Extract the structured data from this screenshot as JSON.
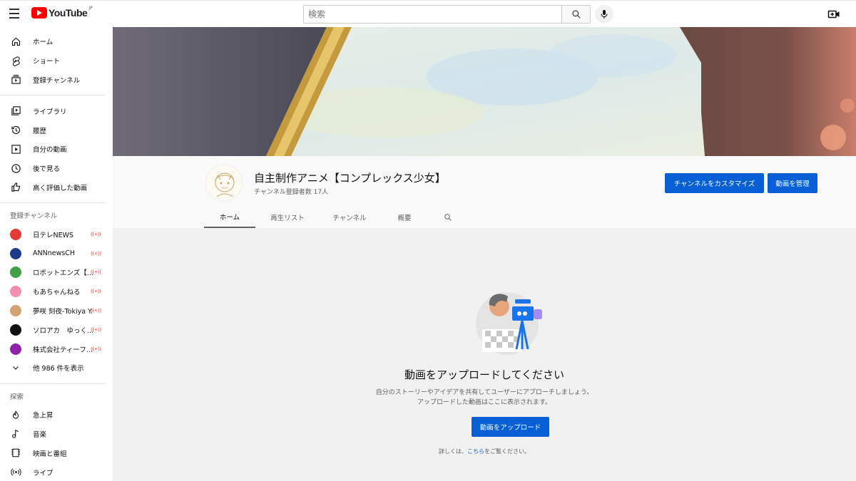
{
  "header": {
    "logo_text": "YouTube",
    "logo_region": "JP",
    "search_placeholder": "検索"
  },
  "sidebar": {
    "primary": [
      {
        "label": "ホーム",
        "icon": "home-icon"
      },
      {
        "label": "ショート",
        "icon": "shorts-icon"
      },
      {
        "label": "登録チャンネル",
        "icon": "subscriptions-icon"
      }
    ],
    "library": [
      {
        "label": "ライブラリ",
        "icon": "library-icon"
      },
      {
        "label": "履歴",
        "icon": "history-icon"
      },
      {
        "label": "自分の動画",
        "icon": "your-videos-icon"
      },
      {
        "label": "後で見る",
        "icon": "watch-later-icon"
      },
      {
        "label": "高く評価した動画",
        "icon": "liked-icon"
      }
    ],
    "subscriptions_heading": "登録チャンネル",
    "subscriptions": [
      {
        "label": "日テレNEWS",
        "color": "#e53935",
        "live": true
      },
      {
        "label": "ANNnewsCH",
        "color": "#1e3a8a",
        "live": true
      },
      {
        "label": "ロボットエンズ【...",
        "color": "#43a047",
        "live": true
      },
      {
        "label": "もあちゃんねる",
        "color": "#f48fb1",
        "live": true
      },
      {
        "label": "夢咲 刻夜-Tokiya Y...",
        "color": "#d4a373",
        "live": true
      },
      {
        "label": "ソロアカ　ゆっく...",
        "color": "#111111",
        "live": true
      },
      {
        "label": "株式会社ティーフ...",
        "color": "#8e24aa",
        "live": true
      }
    ],
    "show_more": "他 986 件を表示",
    "explore_heading": "探索",
    "explore": [
      {
        "label": "急上昇",
        "icon": "trending-icon"
      },
      {
        "label": "音楽",
        "icon": "music-icon"
      },
      {
        "label": "映画と番組",
        "icon": "movies-icon"
      },
      {
        "label": "ライブ",
        "icon": "live-icon"
      }
    ],
    "live_mark": "((•))"
  },
  "channel": {
    "title": "自主制作アニメ【コンプレックス少女】",
    "subscribers": "チャンネル登録者数 17人",
    "customize_button": "チャンネルをカスタマイズ",
    "manage_button": "動画を管理",
    "tabs": [
      "ホーム",
      "再生リスト",
      "チャンネル",
      "概要"
    ],
    "active_tab": 0
  },
  "empty_state": {
    "title": "動画をアップロードしてください",
    "desc_line1": "自分のストーリーやアイデアを共有してユーザーにアプローチしましょう。",
    "desc_line2": "アップロードした動画はここに表示されます。",
    "upload_button": "動画をアップロード",
    "learn_prefix": "詳しくは、",
    "learn_link": "こちら",
    "learn_suffix": "をご覧ください。"
  }
}
